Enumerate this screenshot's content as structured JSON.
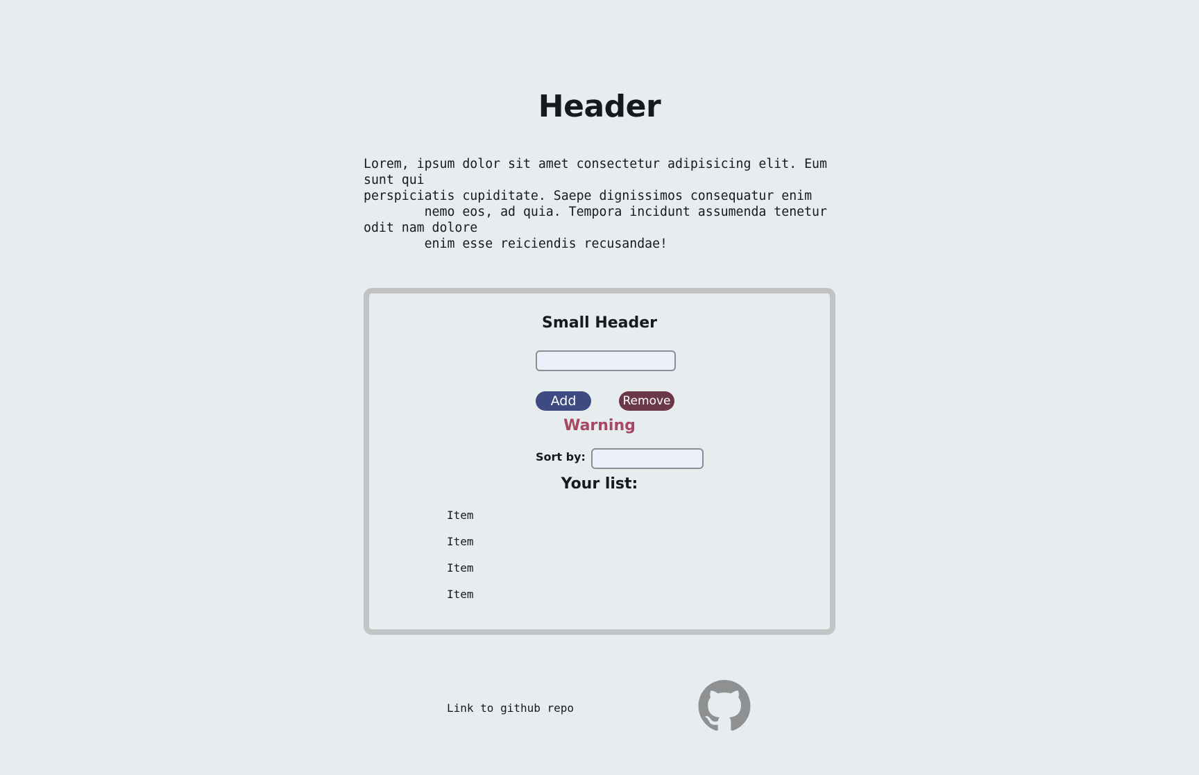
{
  "header": {
    "title": "Header"
  },
  "intro": {
    "text": "Lorem, ipsum dolor sit amet consectetur adipisicing elit. Eum\nsunt qui\nperspiciatis cupiditate. Saepe dignissimos consequatur enim\n        nemo eos, ad quia. Tempora incidunt assumenda tenetur\nodit nam dolore\n        enim esse reiciendis recusandae!"
  },
  "card": {
    "title": "Small Header",
    "input_value": "",
    "add_label": "Add",
    "remove_label": "Remove",
    "warning": "Warning",
    "sort_label": "Sort by:",
    "sort_value": "",
    "list_title": "Your list:",
    "items": [
      "Item",
      "Item",
      "Item",
      "Item"
    ]
  },
  "footer": {
    "link_text": "Link to github repo",
    "icon": "github-icon"
  },
  "colors": {
    "background": "#e7ecef",
    "card_border": "#c2c3c4",
    "add_button": "#3e4a82",
    "remove_button": "#6b3847",
    "warning": "#a84761",
    "github_icon": "#8e9092"
  }
}
